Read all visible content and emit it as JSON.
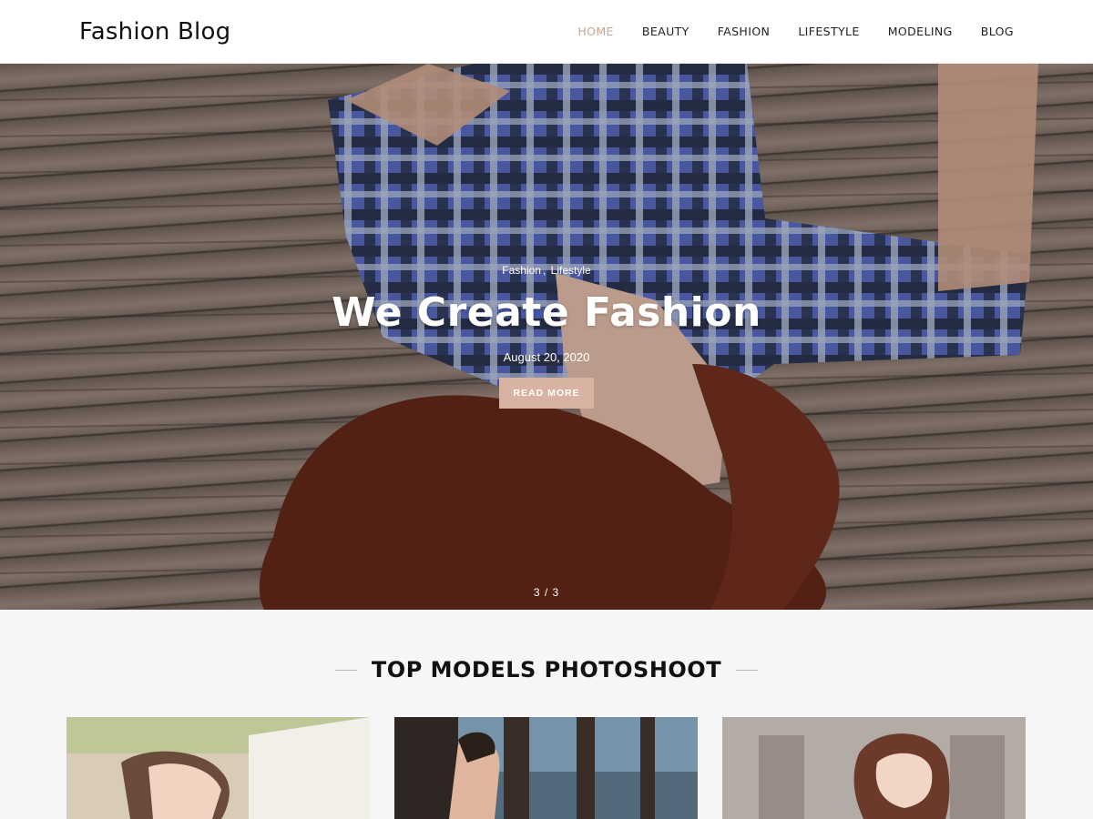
{
  "header": {
    "logo": "Fashion Blog",
    "nav": [
      {
        "label": "HOME",
        "active": true
      },
      {
        "label": "BEAUTY"
      },
      {
        "label": "FASHION"
      },
      {
        "label": "LIFESTYLE"
      },
      {
        "label": "MODELING"
      },
      {
        "label": "BLOG"
      }
    ]
  },
  "hero": {
    "categories": [
      "Fashion",
      "Lifestyle"
    ],
    "category_separator": ",",
    "title": "We Create Fashion",
    "date": "August 20, 2020",
    "button_label": "READ MORE",
    "slide_counter": "3 / 3"
  },
  "section": {
    "title": "TOP MODELS PHOTOSHOOT"
  },
  "colors": {
    "accent": "#d8b3a2",
    "nav_active": "#c9a48f"
  }
}
